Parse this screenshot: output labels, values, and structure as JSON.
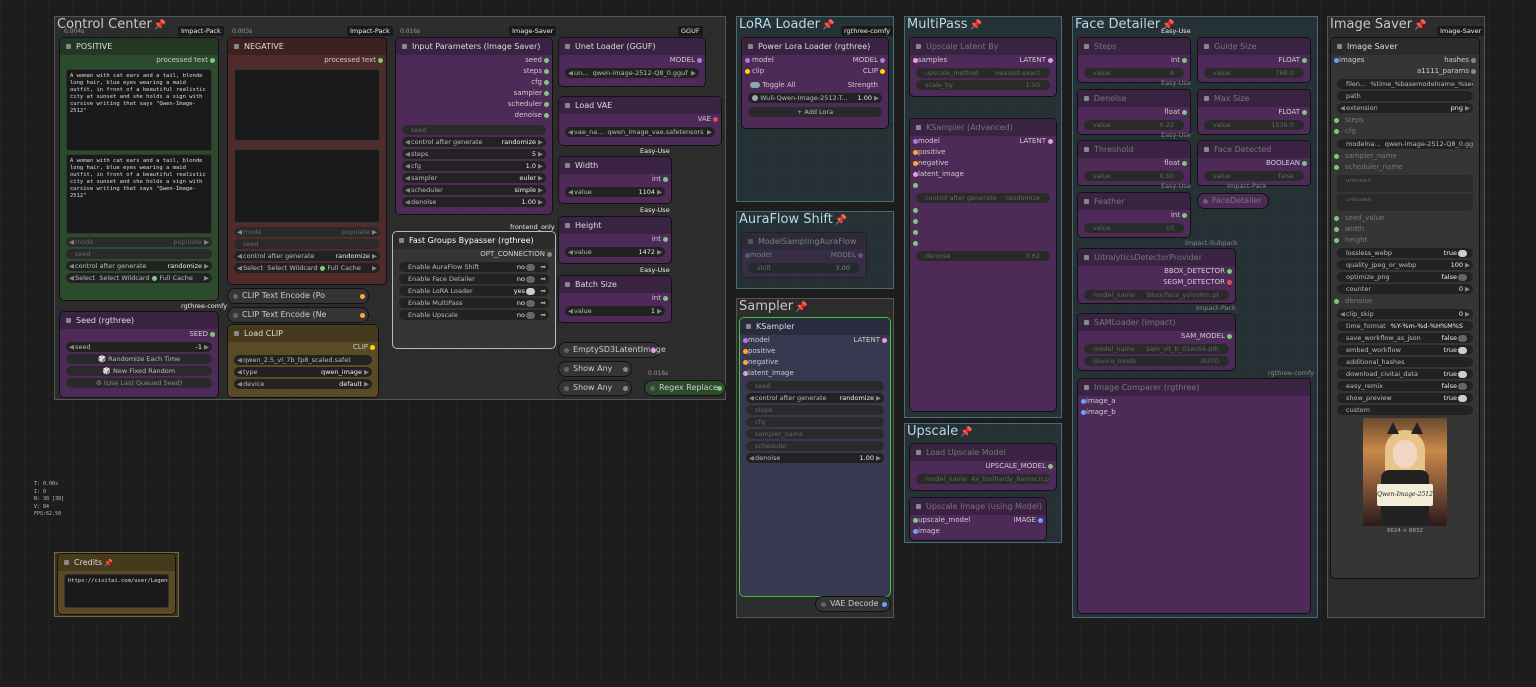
{
  "badges": {
    "impact_pack": "Impact-Pack",
    "image_saver": "Image-Saver",
    "gguf": "GGUF",
    "easy_use": "Easy-Use",
    "frontend_only": "frontend_only",
    "rgthree_comfy": "rgthree-comfy",
    "impact_subpack": "Impact-Subpack"
  },
  "timings": {
    "t1": "0.004s",
    "t2": "0.003s",
    "t3": "0.016s",
    "t4": "0.016s"
  },
  "groups": {
    "control_center": "Control Center",
    "lora_loader": "LoRA Loader",
    "auraflow_shift": "AuraFlow Shift",
    "sampler": "Sampler",
    "multipass": "MultiPass",
    "upscale": "Upscale",
    "face_detailer": "Face Detailer",
    "image_saver": "Image Saver"
  },
  "positive": {
    "title": "POSITIVE",
    "output": "processed text",
    "text1": "A woman with cat ears and a tail, blonde long hair, blue eyes wearing a maid outfit, in front of a beautiful realistic city at sunset and she holds a sign with cursive writing that says \"Qwen-Image-2512\"",
    "text2": "A woman with cat ears and a tail, blonde long hair, blue eyes wearing a maid outfit, in front of a beautiful realistic city at sunset and she holds a sign with cursive writing that says \"Qwen-Image-2512\"",
    "mode_label": "mode",
    "mode_value": "populate",
    "seed_label": "seed",
    "cag_label": "control after generate",
    "cag_value": "randomize",
    "select_label": "Select",
    "select_value": "Select Wildcard",
    "cache_label": "Full Cache"
  },
  "negative": {
    "title": "NEGATIVE",
    "output": "processed text",
    "mode_label": "mode",
    "mode_value": "populate",
    "seed_label": "seed",
    "cag_label": "control after generate",
    "cag_value": "randomize",
    "select_label": "Select",
    "select_value": "Select Wildcard",
    "cache_label": "Full Cache"
  },
  "seed_node": {
    "title": "Seed (rgthree)",
    "output": "SEED",
    "seed_label": "seed",
    "seed_value": "-1",
    "btn1": "Randomize Each Time",
    "btn2": "New Fixed Random",
    "btn3": "(Use Last Queued Seed)"
  },
  "clip_text_encode_pos": "CLIP Text Encode (Po",
  "clip_text_encode_neg": "CLIP Text Encode (Ne",
  "load_clip": {
    "title": "Load CLIP",
    "output": "CLIP",
    "clip_name": "qwen_2.5_vl_7b_fp8_scaled.safet",
    "type_label": "type",
    "type_value": "qwen_image",
    "device_label": "device",
    "device_value": "default"
  },
  "input_params": {
    "title": "Input Parameters (Image Saver)",
    "outputs": [
      "seed",
      "steps",
      "cfg",
      "sampler",
      "scheduler",
      "denoise"
    ],
    "seed_label": "seed",
    "widgets": [
      {
        "label": "control after generate",
        "value": "randomize"
      },
      {
        "label": "steps",
        "value": "5"
      },
      {
        "label": "cfg",
        "value": "1.0"
      },
      {
        "label": "sampler",
        "value": "euler"
      },
      {
        "label": "scheduler",
        "value": "simple"
      },
      {
        "label": "denoise",
        "value": "1.00"
      }
    ]
  },
  "fast_groups": {
    "title": "Fast Groups Bypasser (rgthree)",
    "output": "OPT_CONNECTION",
    "items": [
      {
        "label": "Enable AuraFlow Shift",
        "value": "no"
      },
      {
        "label": "Enable Face Detailer",
        "value": "no"
      },
      {
        "label": "Enable LoRA Loader",
        "value": "yes"
      },
      {
        "label": "Enable MultiPass",
        "value": "no"
      },
      {
        "label": "Enable Upscale",
        "value": "no"
      }
    ]
  },
  "unet_loader": {
    "title": "Unet Loader (GGUF)",
    "output": "MODEL",
    "unet_label": "un...",
    "unet_value": "qwen-image-2512-Q8_0.gguf"
  },
  "load_vae": {
    "title": "Load VAE",
    "output": "VAE",
    "vae_label": "vae_na...",
    "vae_value": "qwen_image_vae.safetensors"
  },
  "width": {
    "title": "Width",
    "output": "int",
    "label": "value",
    "value": "1104"
  },
  "height": {
    "title": "Height",
    "output": "int",
    "label": "value",
    "value": "1472"
  },
  "batch": {
    "title": "Batch Size",
    "output": "int",
    "label": "value",
    "value": "1"
  },
  "empty_latent": "EmptySD3LatentImage",
  "show_any1": "Show Any",
  "show_any2": "Show Any",
  "regex_replace": "Regex Replace",
  "power_lora": {
    "title": "Power Lora Loader (rgthree)",
    "in1": "model",
    "in2": "clip",
    "out1": "MODEL",
    "out2": "CLIP",
    "toggle_all": "Toggle All",
    "strength": "Strength",
    "lora_name": "Wuli-Qwen-Image-2512-T...",
    "lora_strength": "1.00",
    "add_lora": "Add Lora"
  },
  "model_sampling": {
    "title": "ModelSamplingAuraFlow",
    "in": "model",
    "out": "MODEL",
    "shift_label": "shift",
    "shift_value": "3.00"
  },
  "ksampler": {
    "title": "KSampler",
    "output": "LATENT",
    "inputs": [
      "model",
      "positive",
      "negative",
      "latent_image"
    ],
    "seed_label": "seed",
    "cag_label": "control after generate",
    "cag_value": "randomize",
    "steps_label": "steps",
    "cfg_label": "cfg",
    "sampler_label": "sampler_name",
    "scheduler_label": "scheduler",
    "denoise_label": "denoise",
    "denoise_value": "1.00"
  },
  "vae_decode": "VAE Decode",
  "upscale_latent": {
    "title": "Upscale Latent By",
    "in": "samples",
    "out": "LATENT",
    "method_label": "upscale_method",
    "method_value": "nearest-exact",
    "scale_label": "scale_by",
    "scale_value": "1.50"
  },
  "ksampler_adv": {
    "title": "KSampler (Advanced)",
    "out": "LATENT",
    "inputs": [
      "model",
      "positive",
      "negative",
      "latent_image"
    ],
    "cag_label": "control after generate",
    "cag_value": "randomize",
    "denoise_label": "denoise",
    "denoise_value": "0.62"
  },
  "load_upscale": {
    "title": "Load Upscale Model",
    "out": "UPSCALE_MODEL",
    "name_label": "model_name",
    "name_value": "4x_foolhardy_Remacri.pth"
  },
  "upscale_image": {
    "title": "Upscale Image (using Model)",
    "in1": "upscale_model",
    "in2": "image",
    "out": "IMAGE"
  },
  "fd_steps": {
    "title": "Steps",
    "out": "int",
    "label": "value",
    "value": "4"
  },
  "fd_denoise": {
    "title": "Denoise",
    "out": "float",
    "label": "value",
    "value": "0.22"
  },
  "fd_threshold": {
    "title": "Threshold",
    "out": "float",
    "label": "value",
    "value": "0.50"
  },
  "fd_feather": {
    "title": "Feather",
    "out": "int",
    "label": "value",
    "value": "10"
  },
  "fd_guide": {
    "title": "Guide Size",
    "out": "FLOAT",
    "label": "value",
    "value": "768.0"
  },
  "fd_max": {
    "title": "Max Size",
    "out": "FLOAT",
    "label": "value",
    "value": "1536.0"
  },
  "fd_face": {
    "title": "Face Detected",
    "out": "BOOLEAN",
    "label": "value",
    "value": "false"
  },
  "fd_facedetailer": "FaceDetailer",
  "ultralytics": {
    "title": "UltralyticsDetectorProvider",
    "out1": "BBOX_DETECTOR",
    "out2": "SEGM_DETECTOR",
    "label": "model_name",
    "value": "bbox/face_yolov8m.pt"
  },
  "sam_loader": {
    "title": "SAMLoader (Impact)",
    "out": "SAM_MODEL",
    "name_label": "model_name",
    "name_value": "sam_vit_b_01ec64.pth",
    "device_label": "device_mode",
    "device_value": "AUTO"
  },
  "image_comparer": {
    "title": "Image Comparer (rgthree)",
    "in1": "image_a",
    "in2": "image_b"
  },
  "image_saver": {
    "title": "Image Saver",
    "in1": "images",
    "out1": "hashes",
    "out2": "a1111_params",
    "filename_label": "filen...",
    "filename_value": "%time_%basemodelname_%seed",
    "path_label": "path",
    "ext_label": "extension",
    "ext_value": "png",
    "steps_label": "steps",
    "cfg_label": "cfg",
    "modelname_label": "modelna...",
    "modelname_value": "qwen-image-2512-Q8_0.gguf",
    "sampler_label": "sampler_name",
    "scheduler_label": "scheduler_name",
    "unknown1": "unknown",
    "unknown2": "unknown",
    "seed_label": "seed_value",
    "width_label": "width",
    "height_label": "height",
    "widgets": [
      {
        "label": "lossless_webp",
        "value": "true"
      },
      {
        "label": "quality_jpeg_or_webp",
        "value": "100"
      },
      {
        "label": "optimize_png",
        "value": "false"
      },
      {
        "label": "counter",
        "value": "0"
      }
    ],
    "denoise_label": "denoise",
    "clip_skip_label": "clip_skip",
    "clip_skip_value": "0",
    "widgets2": [
      {
        "label": "time_format",
        "value": "%Y-%m-%d-%H%M%S"
      },
      {
        "label": "save_workflow_as_json",
        "value": "false"
      },
      {
        "label": "embed_workflow",
        "value": "true"
      },
      {
        "label": "additional_hashes",
        "value": ""
      },
      {
        "label": "download_civitai_data",
        "value": "true"
      },
      {
        "label": "easy_remix",
        "value": "false"
      },
      {
        "label": "show_preview",
        "value": "true"
      },
      {
        "label": "custom",
        "value": ""
      }
    ],
    "preview_size": "6624 × 8832",
    "sign_text": "Qwen-Image-2512"
  },
  "credits": {
    "title": "Credits",
    "text": "https://civitai.com/user/Legendaer"
  },
  "stats": [
    "T: 0.00s",
    "I: 0",
    "N: 38 [38]",
    "V: 84",
    "FPS:62.50"
  ],
  "colors": {
    "pin": "#e23d5c",
    "link_green": "#7ec77e",
    "link_yellow": "#ffd500",
    "link_red": "#e05050",
    "link_purple": "#b07ad6",
    "link_blue": "#6aa0ff"
  }
}
